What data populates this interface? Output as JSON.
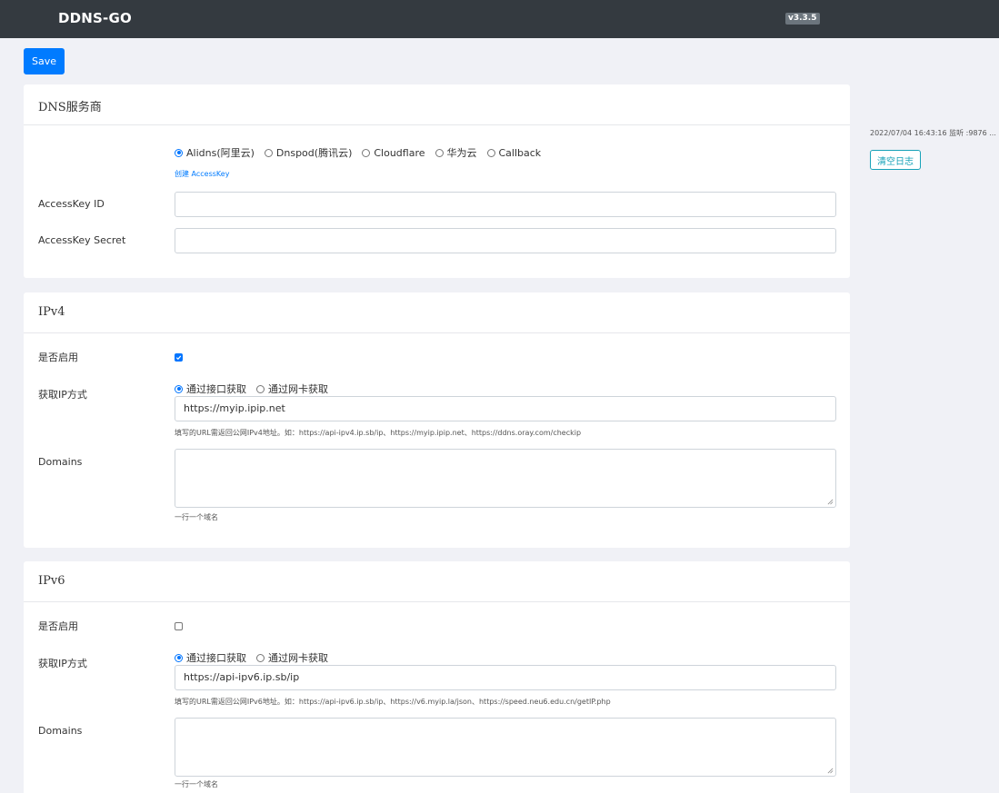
{
  "navbar": {
    "brand": "DDNS-GO",
    "version": "v3.3.5"
  },
  "toolbar": {
    "save_label": "Save"
  },
  "dns": {
    "title": "DNS服务商",
    "providers": [
      {
        "label": "Alidns(阿里云)",
        "checked": true
      },
      {
        "label": "Dnspod(腾讯云)",
        "checked": false
      },
      {
        "label": "Cloudflare",
        "checked": false
      },
      {
        "label": "华为云",
        "checked": false
      },
      {
        "label": "Callback",
        "checked": false
      }
    ],
    "create_key_link": "创建 AccessKey",
    "access_key_id_label": "AccessKey ID",
    "access_key_id_value": "",
    "access_key_secret_label": "AccessKey Secret",
    "access_key_secret_value": ""
  },
  "ipv4": {
    "title": "IPv4",
    "enable_label": "是否启用",
    "enabled": true,
    "method_label": "获取IP方式",
    "method_options": [
      {
        "label": "通过接口获取",
        "checked": true
      },
      {
        "label": "通过网卡获取",
        "checked": false
      }
    ],
    "url_value": "https://myip.ipip.net",
    "url_hint": "填写的URL需返回公网IPv4地址。如：https://api-ipv4.ip.sb/ip、https://myip.ipip.net、https://ddns.oray.com/checkip",
    "domains_label": "Domains",
    "domains_value": "",
    "domains_hint": "一行一个域名"
  },
  "ipv6": {
    "title": "IPv6",
    "enable_label": "是否启用",
    "enabled": false,
    "method_label": "获取IP方式",
    "method_options": [
      {
        "label": "通过接口获取",
        "checked": true
      },
      {
        "label": "通过网卡获取",
        "checked": false
      }
    ],
    "url_value": "https://api-ipv6.ip.sb/ip",
    "url_hint": "填写的URL需返回公网IPv6地址。如：https://api-ipv6.ip.sb/ip、https://v6.myip.la/json、https://speed.neu6.edu.cn/getIP.php",
    "domains_label": "Domains",
    "domains_value": "",
    "domains_hint": "一行一个域名"
  },
  "log": {
    "line": "2022/07/04 16:43:16 监听 :9876 ...",
    "clear_label": "清空日志"
  },
  "colors": {
    "primary": "#007bff",
    "navbar": "#343a40",
    "info": "#17a2b8",
    "background": "#f0f1f6"
  }
}
